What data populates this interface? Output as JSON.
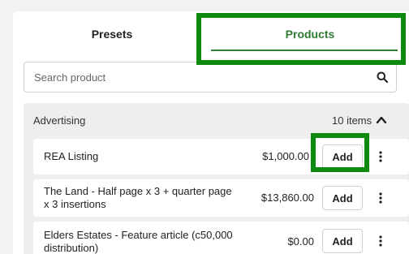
{
  "tabs": [
    {
      "label": "Presets"
    },
    {
      "label": "Products"
    }
  ],
  "search": {
    "placeholder": "Search product",
    "value": ""
  },
  "group": {
    "title": "Advertising",
    "count": "10 items",
    "rows": [
      {
        "name": "REA Listing",
        "price": "$1,000.00",
        "add_label": "Add"
      },
      {
        "name": "The Land - Half page x 3 + quarter page x 3 insertions",
        "price": "$13,860.00",
        "add_label": "Add"
      },
      {
        "name": "Elders Estates - Feature article (c50,000 distribution)",
        "price": "$0.00",
        "add_label": "Add"
      }
    ]
  },
  "colors": {
    "accent": "#2e7d32",
    "highlight": "#0e8a0e"
  }
}
